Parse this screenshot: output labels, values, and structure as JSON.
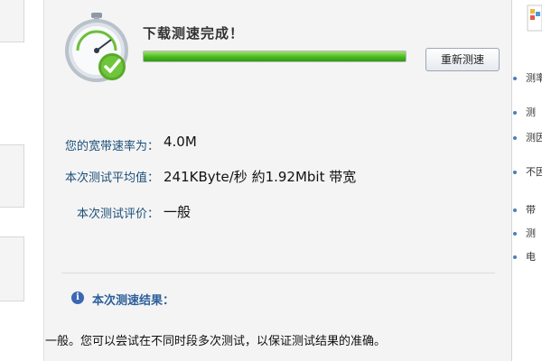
{
  "header": {
    "status_title": "下载测速完成！",
    "progress": 1.0,
    "retest_label": "重新测速"
  },
  "results": {
    "bandwidth_label": "您的宽带速率为：",
    "bandwidth_value": "4.0M",
    "avg_label": "本次测试平均值：",
    "avg_value": "241KByte/秒 約1.92Mbit 带宽",
    "rating_label": "本次测试评价：",
    "rating_value": "一般"
  },
  "summary": {
    "title": "本次测速结果：",
    "text": "一般。您可以尝试在不同时段多次测试，以保证测试结果的准确。"
  },
  "right_sidebar": {
    "links": [
      {
        "label": "测率"
      },
      {
        "label": "测"
      },
      {
        "label": "测因"
      },
      {
        "label": "不因"
      },
      {
        "label": "带"
      },
      {
        "label": "测"
      },
      {
        "label": "电"
      }
    ]
  },
  "colors": {
    "progress_green": "#44b51e",
    "label_blue": "#1a4f7a",
    "link_dot": "#4a7fb8"
  },
  "icons": {
    "stopwatch": "stopwatch-check-icon",
    "info": "info-icon"
  }
}
